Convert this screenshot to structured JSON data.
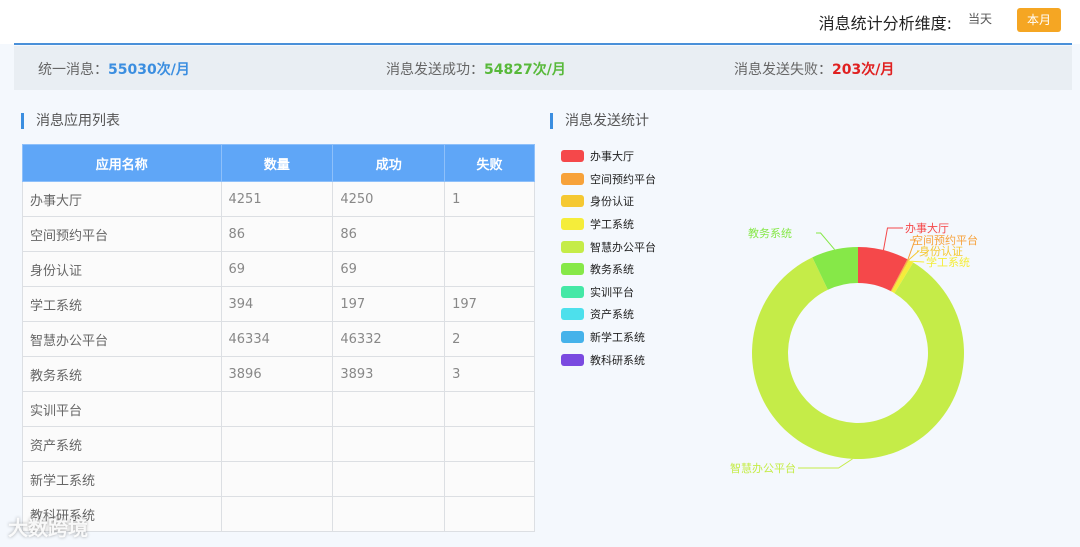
{
  "header": {
    "dimension_label": "消息统计分析维度:",
    "today_button": "当天",
    "month_button": "本月"
  },
  "summary": {
    "unified_label": "统一消息：",
    "unified_value": "55030次/月",
    "success_label": "消息发送成功：",
    "success_value": "54827次/月",
    "fail_label": "消息发送失败：",
    "fail_value": "203次/月"
  },
  "list_section": {
    "title": "消息应用列表",
    "columns": [
      "应用名称",
      "数量",
      "成功",
      "失败"
    ],
    "rows": [
      [
        "办事大厅",
        "4251",
        "4250",
        "1"
      ],
      [
        "空间预约平台",
        "86",
        "86",
        ""
      ],
      [
        "身份认证",
        "69",
        "69",
        ""
      ],
      [
        "学工系统",
        "394",
        "197",
        "197"
      ],
      [
        "智慧办公平台",
        "46334",
        "46332",
        "2"
      ],
      [
        "教务系统",
        "3896",
        "3893",
        "3"
      ],
      [
        "实训平台",
        "",
        "",
        ""
      ],
      [
        "资产系统",
        "",
        "",
        ""
      ],
      [
        "新学工系统",
        "",
        "",
        ""
      ],
      [
        "教科研系统",
        "",
        "",
        ""
      ]
    ]
  },
  "chart_section": {
    "title": "消息发送统计"
  },
  "chart_data": {
    "type": "pie",
    "donut": true,
    "legend_position": "top-left",
    "series": [
      {
        "name": "办事大厅",
        "value": 4251,
        "color": "#f5484a"
      },
      {
        "name": "空间预约平台",
        "value": 86,
        "color": "#f7a23a"
      },
      {
        "name": "身份认证",
        "value": 69,
        "color": "#f5c832"
      },
      {
        "name": "学工系统",
        "value": 394,
        "color": "#f5ed3a"
      },
      {
        "name": "智慧办公平台",
        "value": 46334,
        "color": "#c5ec48"
      },
      {
        "name": "教务系统",
        "value": 3896,
        "color": "#86e848"
      },
      {
        "name": "实训平台",
        "value": 0,
        "color": "#44e8a6"
      },
      {
        "name": "资产系统",
        "value": 0,
        "color": "#4de0ec"
      },
      {
        "name": "新学工系统",
        "value": 0,
        "color": "#45b2ea"
      },
      {
        "name": "教科研系统",
        "value": 0,
        "color": "#7a4ae0"
      }
    ]
  },
  "watermark": "大数跨境"
}
